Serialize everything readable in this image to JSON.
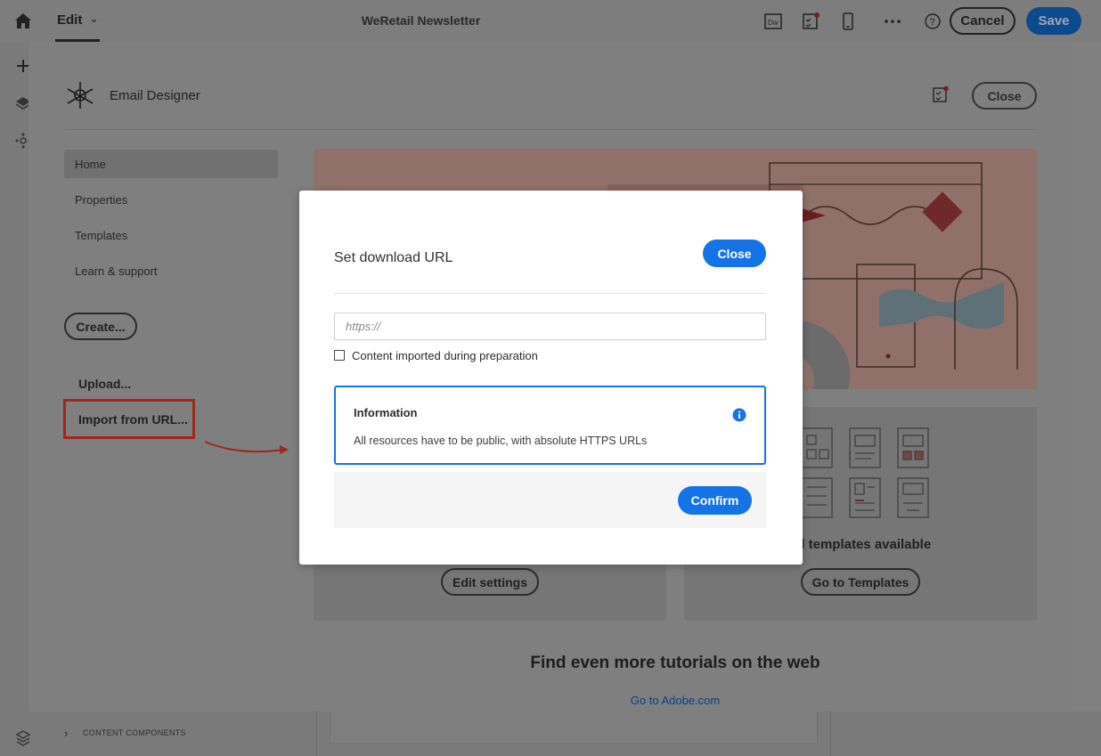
{
  "app": {
    "edit_label": "Edit",
    "document_title": "WeRetail Newsletter",
    "cancel_label": "Cancel",
    "save_label": "Save"
  },
  "bottom": {
    "panel_label": "CONTENT COMPONENTS"
  },
  "designer": {
    "title": "Email Designer",
    "close_label": "Close",
    "nav": [
      {
        "label": "Home",
        "active": true
      },
      {
        "label": "Properties",
        "active": false
      },
      {
        "label": "Templates",
        "active": false
      },
      {
        "label": "Learn & support",
        "active": false
      }
    ],
    "create_label": "Create...",
    "upload_label": "Upload...",
    "import_label": "Import from URL...",
    "card_left_button": "Edit settings",
    "card_right_heading": "all templates available",
    "card_right_button": "Go to Templates",
    "tutorials_heading": "Find even more tutorials on the web",
    "adobe_link": "Go to Adobe.com"
  },
  "modal": {
    "title": "Set download URL",
    "close_label": "Close",
    "url_placeholder": "https://",
    "url_value": "",
    "checkbox_label": "Content imported during preparation",
    "checkbox_checked": false,
    "info_title": "Information",
    "info_text": "All resources have to be public, with absolute HTTPS URLs",
    "confirm_label": "Confirm"
  },
  "colors": {
    "accent": "#1473e6",
    "highlight_box": "#a1261b"
  },
  "icons": [
    "home-icon",
    "chevron-down-icon",
    "dreamweaver-icon",
    "checklist-icon",
    "mobile-icon",
    "more-icon",
    "help-icon",
    "add-icon",
    "layers-icon",
    "components-icon",
    "email-designer-logo-icon",
    "info-icon",
    "chevron-right-icon"
  ]
}
